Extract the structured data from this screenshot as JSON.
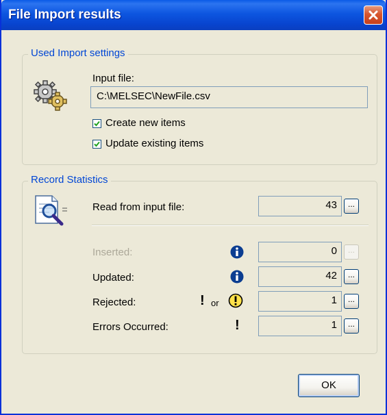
{
  "window": {
    "title": "File Import results"
  },
  "import_settings": {
    "group_title": "Used Import settings",
    "input_file_label": "Input file:",
    "input_file_value": "C:\\MELSEC\\NewFile.csv",
    "create_new_label": "Create new items",
    "create_new_checked": true,
    "update_existing_label": "Update existing items",
    "update_existing_checked": true
  },
  "statistics": {
    "group_title": "Record Statistics",
    "read_label": "Read from input file:",
    "read_value": "43",
    "inserted_label": "Inserted:",
    "inserted_value": "0",
    "updated_label": "Updated:",
    "updated_value": "42",
    "rejected_label": "Rejected:",
    "rejected_value": "1",
    "or_text": "or",
    "errors_label": "Errors Occurred:",
    "errors_value": "1",
    "ellipsis": "..."
  },
  "footer": {
    "ok_label": "OK"
  },
  "colors": {
    "titlebar": "#0a52dd",
    "group_title": "#0046d5",
    "close": "#d8562e",
    "info": "#0b3d91"
  }
}
